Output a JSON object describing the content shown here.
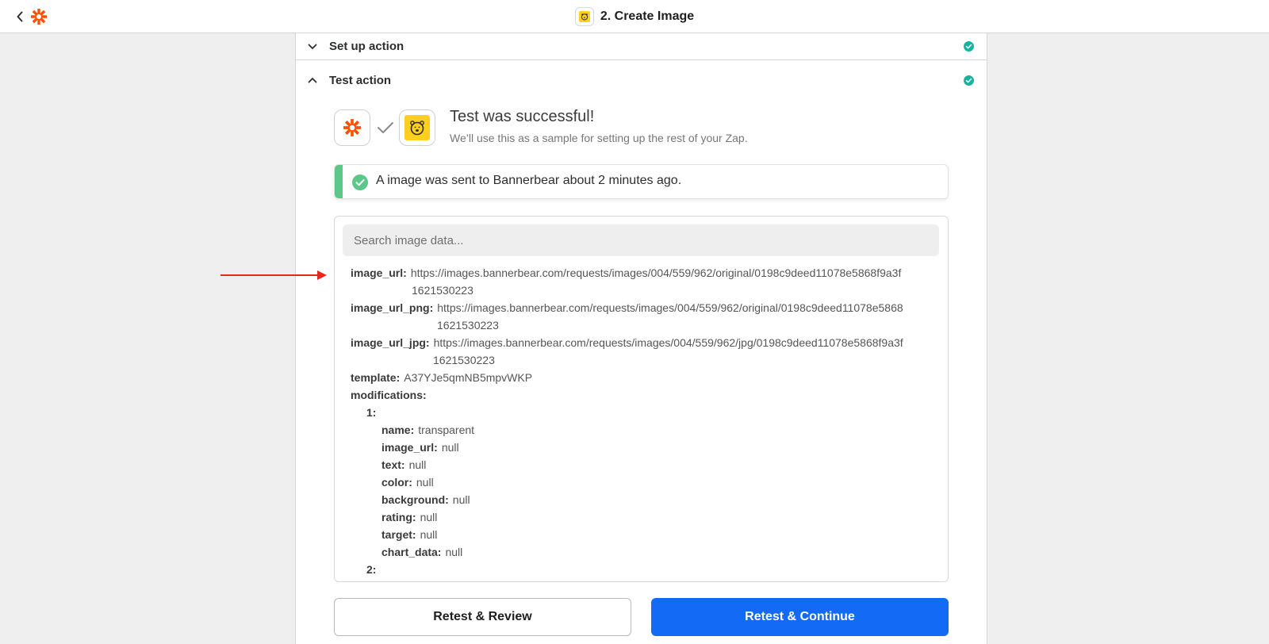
{
  "header": {
    "title": "2. Create Image",
    "back_icon": "chevron-left-icon",
    "logo_icon": "zapier-asterisk-icon"
  },
  "sections": {
    "setup": {
      "label": "Set up action",
      "state": "collapsed",
      "status_icon": "check-circle-icon"
    },
    "test": {
      "label": "Test action",
      "state": "expanded",
      "status_icon": "check-circle-icon"
    }
  },
  "test_result": {
    "title": "Test was successful!",
    "subtitle": "We’ll use this as a sample for setting up the rest of your Zap.",
    "notice": "A image was sent to Bannerbear about 2 minutes ago."
  },
  "data_panel": {
    "search_placeholder": "Search image data...",
    "fields": [
      {
        "key": "image_url:",
        "value": "https://images.bannerbear.com/requests/images/004/559/962/original/0198c9deed11078e5868f9a3f",
        "cont": "1621530223"
      },
      {
        "key": "image_url_png:",
        "value": "https://images.bannerbear.com/requests/images/004/559/962/original/0198c9deed11078e5868",
        "cont": "1621530223"
      },
      {
        "key": "image_url_jpg:",
        "value": "https://images.bannerbear.com/requests/images/004/559/962/jpg/0198c9deed11078e5868f9a3f",
        "cont": "1621530223"
      },
      {
        "key": "template:",
        "value": "A37YJe5qmNB5mpvWKP"
      },
      {
        "key": "modifications:",
        "value": ""
      }
    ],
    "mod_index": "1:",
    "mod_fields": [
      {
        "key": "name:",
        "value": "transparent"
      },
      {
        "key": "image_url:",
        "value": "null"
      },
      {
        "key": "text:",
        "value": "null"
      },
      {
        "key": "color:",
        "value": "null"
      },
      {
        "key": "background:",
        "value": "null"
      },
      {
        "key": "rating:",
        "value": "null"
      },
      {
        "key": "target:",
        "value": "null"
      },
      {
        "key": "chart_data:",
        "value": "null"
      }
    ],
    "next_index": "2:"
  },
  "buttons": {
    "review": "Retest & Review",
    "continue": "Retest & Continue"
  },
  "colors": {
    "accent_blue": "#136bf5",
    "success_green": "#5bc789",
    "status_teal": "#13b5a0",
    "zapier_orange": "#ff4f00",
    "bannerbear_yellow": "#ffcf1f",
    "arrow_red": "#e8281c"
  }
}
